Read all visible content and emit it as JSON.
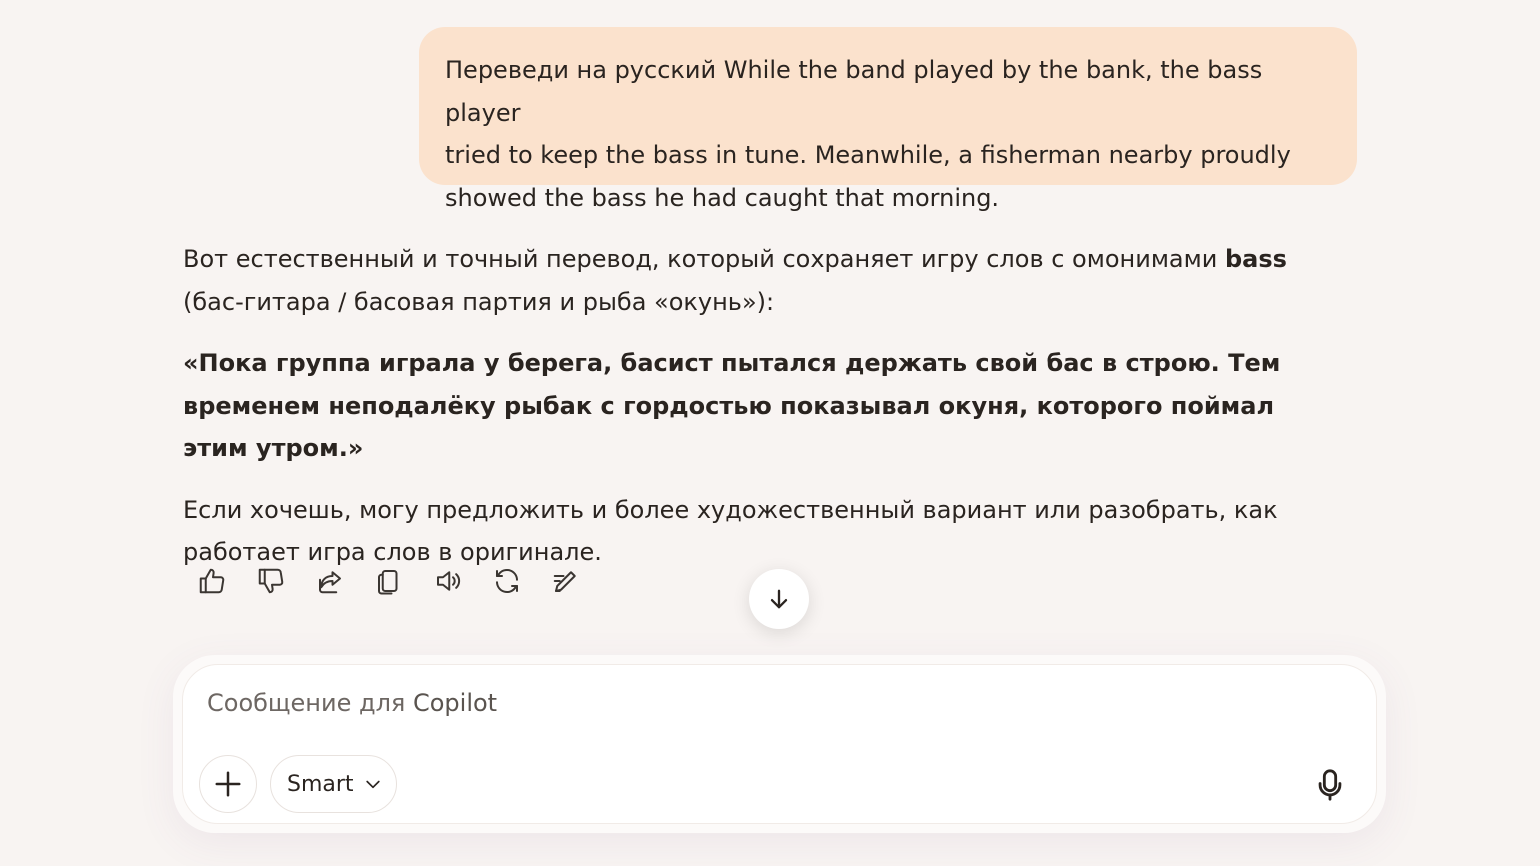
{
  "user_message": {
    "text_line1": "Переведи на русский While the band played by the bank, the bass player",
    "text_line2": "tried to keep the bass in tune. Meanwhile, a fisherman nearby proudly",
    "text_line3": "showed the bass he had caught that morning."
  },
  "assistant_message": {
    "intro_pre": "Вот естественный и точный перевод, который сохраняет игру слов с омонимами ",
    "intro_bold": "bass",
    "intro_post": " (бас-гитара / басовая партия и рыба «окунь»):",
    "translation": "«Пока группа играла у берега, басист пытался держать свой бас в строю. Тем временем неподалёку рыбак с гордостью показывал окуня, которого поймал этим утром.»",
    "followup": "Если хочешь, могу предложить и более художественный вариант или разобрать, как работает игра слов в оригинале."
  },
  "actions": [
    {
      "icon": "thumbs-up-icon"
    },
    {
      "icon": "thumbs-down-icon"
    },
    {
      "icon": "share-icon"
    },
    {
      "icon": "copy-icon"
    },
    {
      "icon": "speaker-icon"
    },
    {
      "icon": "regenerate-icon"
    },
    {
      "icon": "edit-icon"
    }
  ],
  "composer": {
    "placeholder_pre": "Сообщение для ",
    "placeholder_brand": "Copilot",
    "mode_label": "Smart"
  },
  "colors": {
    "background": "#f8f4f2",
    "user_bubble": "#fbe2cd",
    "text": "#2a2420"
  }
}
